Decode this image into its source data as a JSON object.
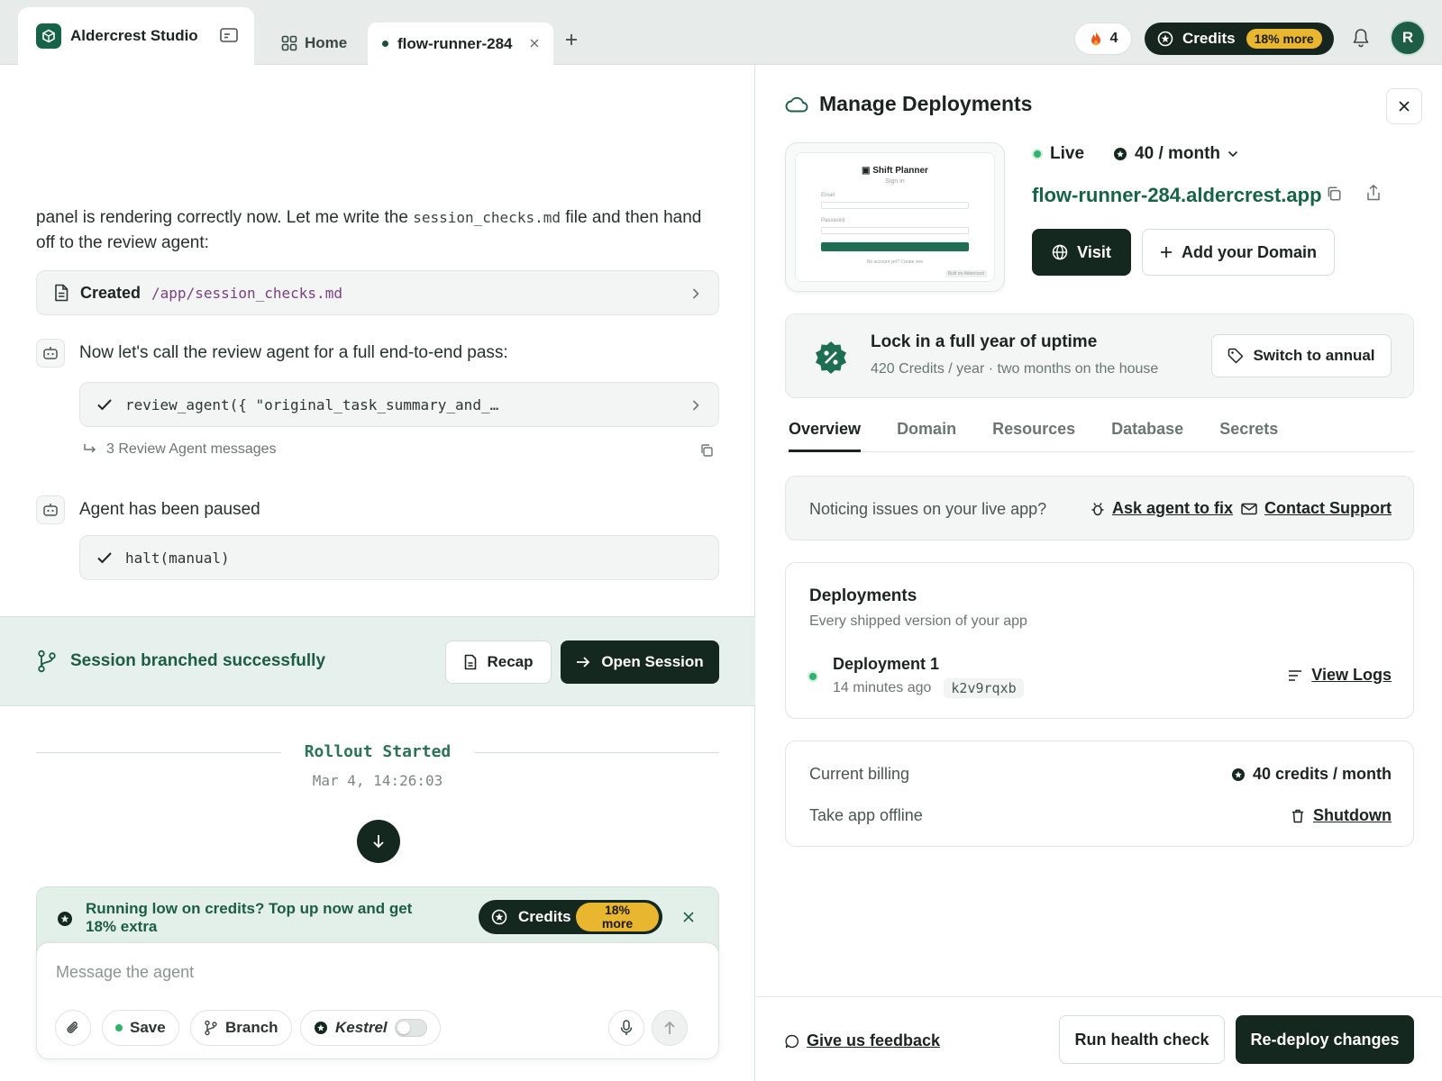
{
  "topbar": {
    "app_name": "Aldercrest Studio",
    "home_tab": "Home",
    "active_tab": "flow-runner-284",
    "streak_count": "4",
    "credits_label": "Credits",
    "credits_badge": "18% more",
    "avatar_initial": "R"
  },
  "chat": {
    "para_before": "panel is rendering correctly now. Let me write the ",
    "para_code": "session_checks.md",
    "para_after": " file and then hand off to the review agent:",
    "file_created_label": "Created",
    "file_path": "/app/session_checks.md",
    "agent_msg_1": "Now let's call the review agent for a full end-to-end pass:",
    "tool_call_1": "review_agent({ \"original_task_summary_and_…",
    "sub_messages": "3 Review Agent messages",
    "agent_msg_2": "Agent has been paused",
    "tool_call_2": "halt(manual)"
  },
  "branch_banner": {
    "message": "Session branched successfully",
    "recap_label": "Recap",
    "open_label": "Open Session"
  },
  "rollout": {
    "title": "Rollout Started",
    "time": "Mar 4, 14:26:03"
  },
  "credit_banner": {
    "text": "Running low on credits? Top up now and get 18% extra",
    "pill_label": "Credits",
    "pill_badge_line1": "18%",
    "pill_badge_line2": "more"
  },
  "composer": {
    "placeholder": "Message the agent",
    "save_label": "Save",
    "branch_label": "Branch",
    "model_label": "Kestrel"
  },
  "panel": {
    "title": "Manage Deployments",
    "preview": {
      "app_title": "Shift Planner",
      "sign_in": "Sign in",
      "email_label": "Email",
      "password_label": "Password",
      "footer": "No account yet? Create one",
      "built": "Built on Aldercrest"
    },
    "status": "Live",
    "plan": "40 / month",
    "domain": "flow-runner-284.aldercrest.app",
    "visit_label": "Visit",
    "add_domain_label": "Add your Domain",
    "annual": {
      "heading": "Lock in a full year of uptime",
      "sub": "420 Credits / year · two months on the house",
      "button": "Switch to annual"
    },
    "tabs": [
      "Overview",
      "Domain",
      "Resources",
      "Database",
      "Secrets"
    ],
    "issues": {
      "question": "Noticing issues on your live app?",
      "ask_agent": "Ask agent to fix",
      "contact": "Contact Support"
    },
    "deployments": {
      "heading": "Deployments",
      "sub": "Every shipped version of your app",
      "item_name": "Deployment 1",
      "item_time": "14 minutes ago",
      "item_hash": "k2v9rqxb",
      "view_logs": "View Logs"
    },
    "billing": {
      "current_label": "Current billing",
      "current_value": "40 credits / month",
      "offline_label": "Take app offline",
      "shutdown_label": "Shutdown"
    },
    "footer": {
      "feedback": "Give us feedback",
      "health_check": "Run health check",
      "redeploy": "Re-deploy changes"
    }
  },
  "colors": {
    "brand_green": "#16634a",
    "dark": "#15281f",
    "badge_yellow": "#e9b62f",
    "live_green": "#2fb36d"
  }
}
